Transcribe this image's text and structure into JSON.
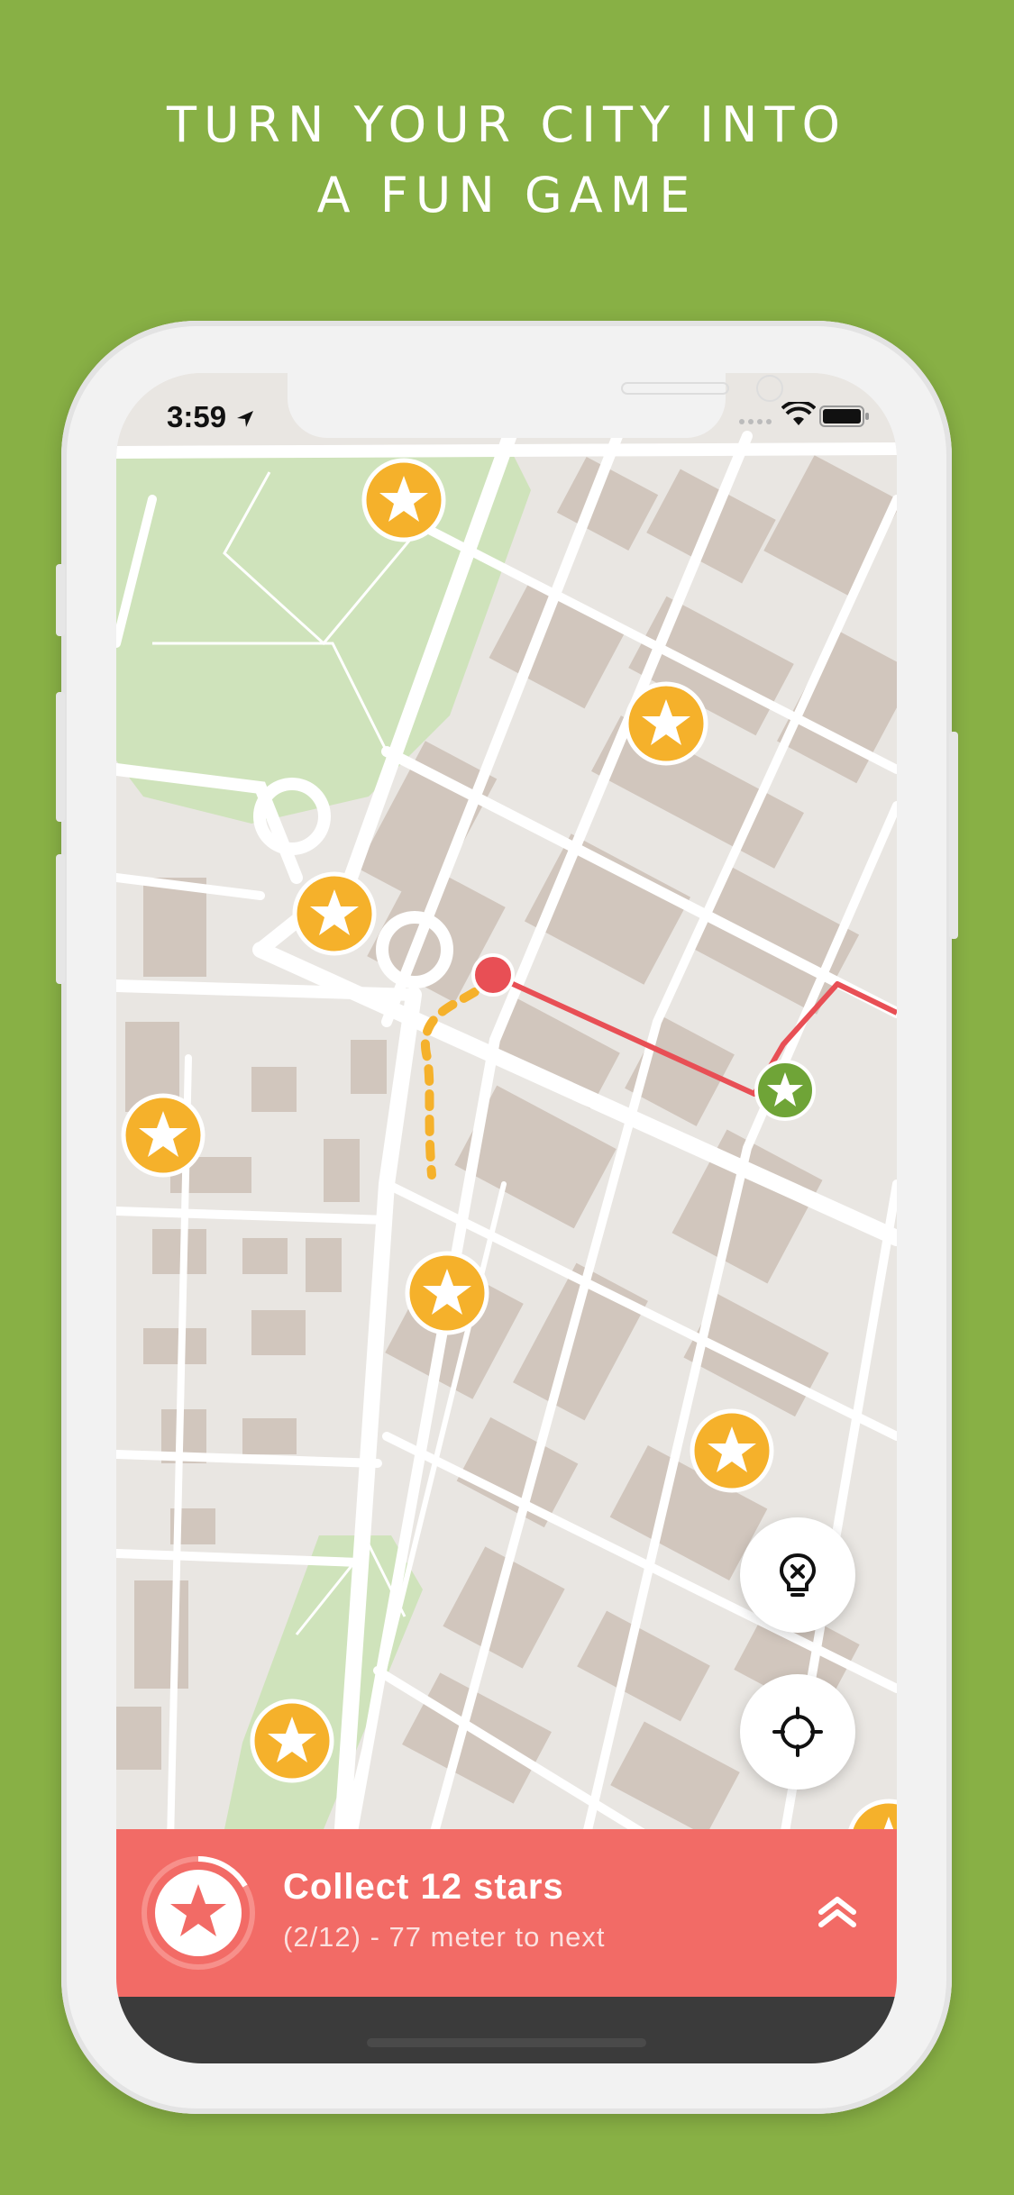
{
  "headline": {
    "line1": "TURN YOUR CITY INTO",
    "line2": "A FUN GAME"
  },
  "status_bar": {
    "time": "3:59",
    "icons": [
      "location-arrow-icon",
      "cellular-icon",
      "wifi-icon",
      "battery-icon"
    ]
  },
  "map": {
    "park_color": "#cfe3bb",
    "building_color": "#d1c6bd",
    "road_color": "#ffffff",
    "star_marker_color": "#f5b12b",
    "collected_marker_color": "#6fa437",
    "route_color": "#e84f55",
    "walk_path_color": "#f5b12b"
  },
  "actions": {
    "hint_icon": "lightbulb-x-icon",
    "locate_icon": "crosshair-icon"
  },
  "mission": {
    "title": "Collect 12 stars",
    "subtitle": "(2/12) - 77 meter to next",
    "collected": 2,
    "total": 12,
    "bar_color": "#f26b66",
    "icon": "star-icon",
    "expand_icon": "double-chevron-up-icon"
  }
}
